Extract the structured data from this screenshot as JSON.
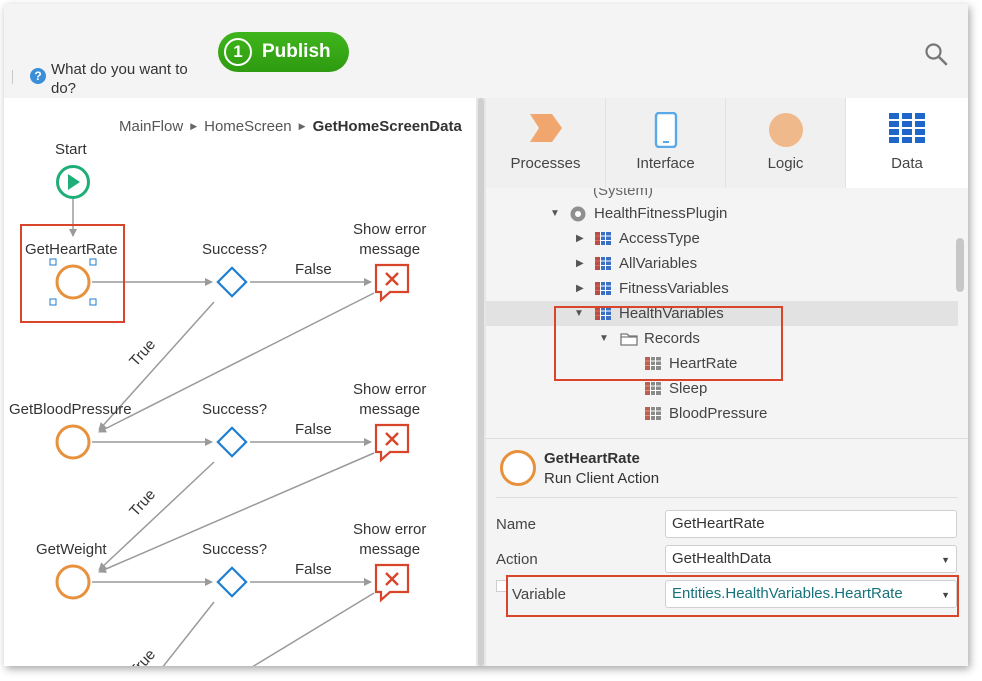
{
  "toolbar": {
    "help_text": "What do you want to do?",
    "publish_count": "1",
    "publish_label": "Publish"
  },
  "breadcrumb": {
    "items": [
      "MainFlow",
      "HomeScreen"
    ],
    "current": "GetHomeScreenData"
  },
  "flow": {
    "start_label": "Start",
    "actions": [
      "GetHeartRate",
      "GetBloodPressure",
      "GetWeight"
    ],
    "if_label": "Success?",
    "false_label": "False",
    "true_label": "True",
    "error_label_line1": "Show error",
    "error_label_line2": "message"
  },
  "tabs": [
    "Processes",
    "Interface",
    "Logic",
    "Data"
  ],
  "tree": {
    "partial_row": "(System)",
    "plugin": "HealthFitnessPlugin",
    "entities": [
      "AccessType",
      "AllVariables",
      "FitnessVariables",
      "HealthVariables"
    ],
    "records_folder": "Records",
    "records": [
      "HeartRate",
      "Sleep",
      "BloodPressure"
    ]
  },
  "properties": {
    "element_name": "GetHeartRate",
    "element_type": "Run Client Action",
    "name_label": "Name",
    "name_value": "GetHeartRate",
    "action_label": "Action",
    "action_value": "GetHealthData",
    "variable_label": "Variable",
    "variable_value": "Entities.HealthVariables.HeartRate"
  },
  "colors": {
    "publish_green": "#3aa818",
    "action_orange": "#e8913c",
    "if_blue": "#1f7fd2",
    "start_green": "#1fae78",
    "error_red": "#d9452b",
    "grid_blue": "#1f66c9",
    "highlight_red": "#d9452b"
  }
}
